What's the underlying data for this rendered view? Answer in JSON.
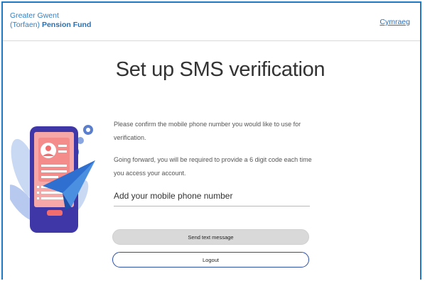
{
  "header": {
    "brand_line1": "Greater Gwent",
    "brand_line2_prefix": "(Torfaen) ",
    "brand_line2_strong": "Pension Fund",
    "language_link": "Cymraeg"
  },
  "main": {
    "title": "Set up SMS verification",
    "paragraph1": "Please confirm the mobile phone number you would like to use for verification.",
    "paragraph2": "Going forward, you will be required to provide a 6 digit code each time you access your account.",
    "phone_field": {
      "value": "",
      "placeholder": "Add your mobile phone number"
    },
    "send_button": "Send text message",
    "logout_button": "Logout"
  },
  "illustration": {
    "icon": "phone-sms-illustration-icon"
  },
  "colors": {
    "brand_blue": "#2f80c8",
    "frame_blue": "#1f79c4",
    "logout_border": "#2a4da8",
    "button_grey": "#d9d9d9"
  }
}
